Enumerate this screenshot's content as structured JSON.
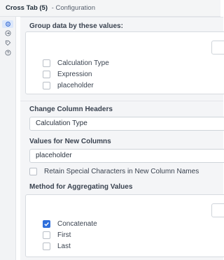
{
  "window": {
    "tool_name": "Cross Tab (5)",
    "separator": "-",
    "section": "Configuration"
  },
  "rail": {
    "icons": [
      "config-icon",
      "arrow-circle-icon",
      "tag-icon",
      "help-icon"
    ]
  },
  "group_by": {
    "label": "Group data by these values:",
    "options": [
      {
        "label": "Calculation Type",
        "checked": false
      },
      {
        "label": "Expression",
        "checked": false
      },
      {
        "label": "placeholder",
        "checked": false
      }
    ]
  },
  "column_headers": {
    "label": "Change Column Headers",
    "value": "Calculation Type"
  },
  "new_columns": {
    "label": "Values for New Columns",
    "value": "placeholder"
  },
  "retain_special": {
    "label": "Retain Special Characters in New Column Names",
    "checked": false
  },
  "aggregation": {
    "label": "Method for Aggregating Values",
    "options": [
      {
        "label": "Concatenate",
        "checked": true
      },
      {
        "label": "First",
        "checked": false
      },
      {
        "label": "Last",
        "checked": false
      }
    ]
  },
  "colors": {
    "accent": "#2f6fdb",
    "panel_bg": "#f4f5f7"
  }
}
